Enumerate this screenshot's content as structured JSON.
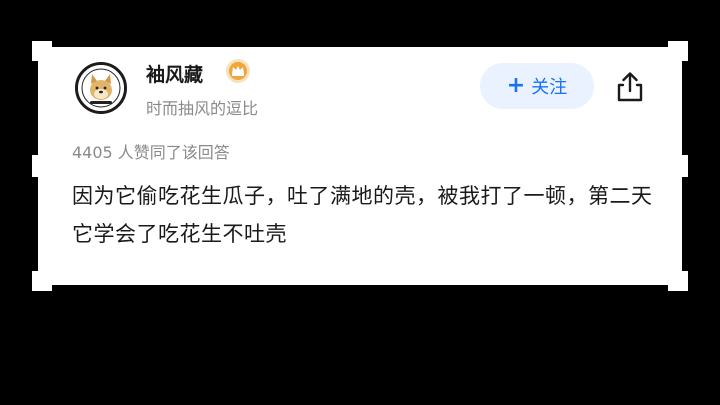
{
  "author": {
    "name": "袖风藏",
    "bio": "时而抽风的逗比",
    "badge_color": "#f0a63a"
  },
  "follow_button": {
    "plus": "+",
    "label": "关注",
    "color": "#1772f6"
  },
  "answer": {
    "upvote_line": "4405 人赞同了该回答",
    "content": "因为它偷吃花生瓜子，吐了满地的壳，被我打了一顿，第二天它学会了吃花生不吐壳"
  },
  "icons": {
    "share": "share-icon",
    "badge": "badge-icon",
    "avatar": "doge-avatar"
  }
}
